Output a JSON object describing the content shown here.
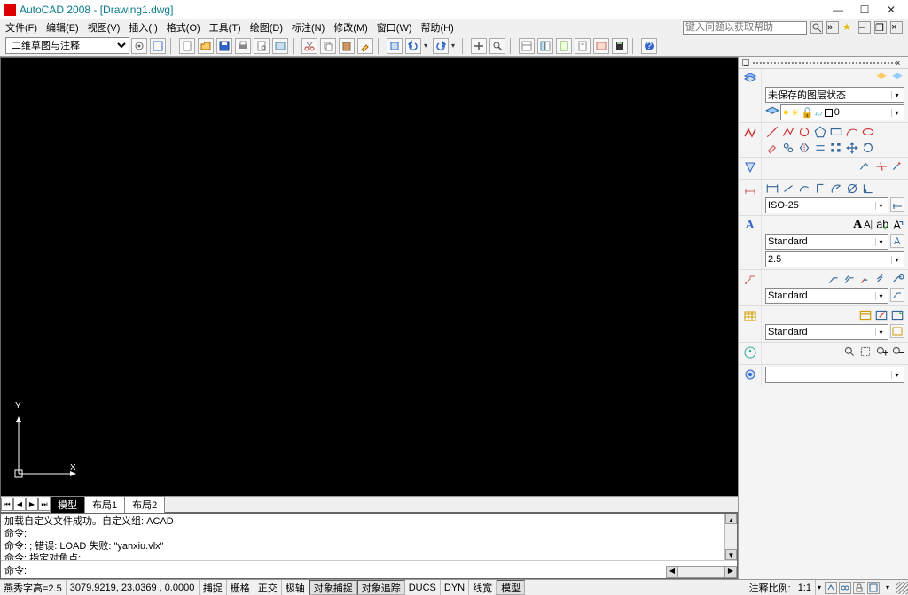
{
  "window": {
    "title": "AutoCAD 2008 - [Drawing1.dwg]"
  },
  "menu": {
    "items": [
      "文件(F)",
      "编辑(E)",
      "视图(V)",
      "插入(I)",
      "格式(O)",
      "工具(T)",
      "绘图(D)",
      "标注(N)",
      "修改(M)",
      "窗口(W)",
      "帮助(H)"
    ],
    "help_placeholder": "键入问题以获取帮助"
  },
  "toolbar": {
    "workspace": "二维草图与注释"
  },
  "tabs": {
    "active": "模型",
    "others": [
      "布局1",
      "布局2"
    ]
  },
  "ucs": {
    "y": "Y",
    "x": "X"
  },
  "palette": {
    "layer_state": "未保存的图层状态",
    "layer_current": "0",
    "dim_style": "ISO-25",
    "text_style": "Standard",
    "text_height": "2.5",
    "mleader_style": "Standard",
    "table_style": "Standard",
    "label_A": "A",
    "label_A2": "A"
  },
  "command": {
    "history": "加载自定义文件成功。自定义组: ACAD\n命令:\n命令: ; 错误: LOAD 失败: \"yanxiu.vlx\"\n命令: 指定对角点:",
    "prompt": "命令:"
  },
  "status": {
    "left1": "燕秀字高=2.5",
    "coords": "3079.9219, 23.0369 , 0.0000",
    "modes": [
      "捕捉",
      "栅格",
      "正交",
      "极轴",
      "对象捕捉",
      "对象追踪",
      "DUCS",
      "DYN",
      "线宽",
      "模型"
    ],
    "anno_label": "注释比例:",
    "anno_scale": "1:1"
  }
}
